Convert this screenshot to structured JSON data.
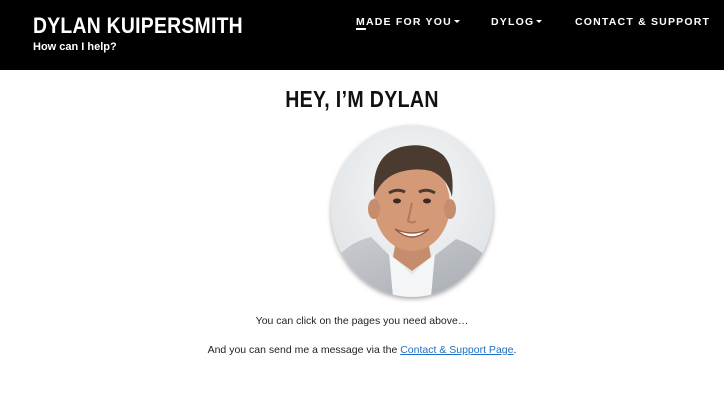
{
  "header": {
    "site_title": "DYLAN KUIPERSMITH",
    "tagline": "How can I help?"
  },
  "nav": {
    "items": [
      {
        "first": "M",
        "rest": "ADE FOR YOU",
        "has_dropdown": true
      },
      {
        "first": "",
        "rest": "DYLOG",
        "has_dropdown": true
      },
      {
        "first": "",
        "rest": "CONTACT & SUPPORT",
        "has_dropdown": false
      }
    ]
  },
  "main": {
    "title": "HEY, I’M DYLAN",
    "line1": "You can click on the pages you need above…",
    "line2_prefix": "And you can send me a message via the ",
    "line2_link": "Contact & Support Page",
    "line2_suffix": "."
  },
  "colors": {
    "header_bg": "#000000",
    "link": "#1f6fc7"
  }
}
